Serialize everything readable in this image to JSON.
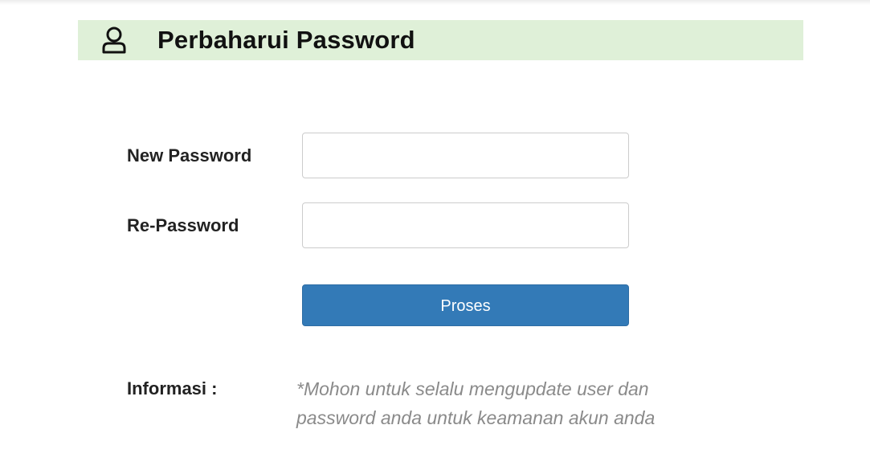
{
  "header": {
    "title": "Perbaharui Password",
    "icon": "user-icon",
    "background_color": "#dff0d8"
  },
  "form": {
    "new_password": {
      "label": "New Password",
      "value": "",
      "placeholder": ""
    },
    "re_password": {
      "label": "Re-Password",
      "value": "",
      "placeholder": ""
    },
    "submit_label": "Proses",
    "submit_color": "#337ab7"
  },
  "info": {
    "label": "Informasi :",
    "text": "*Mohon untuk selalu mengupdate user dan password anda untuk keamanan akun anda"
  }
}
